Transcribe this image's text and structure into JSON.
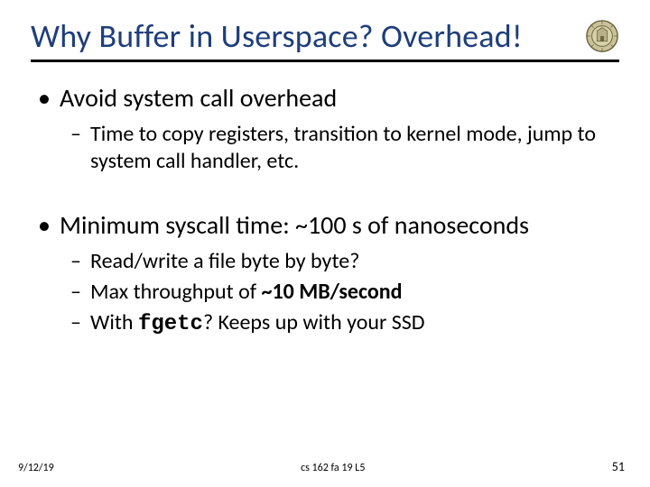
{
  "title": "Why Buffer in Userspace? Overhead!",
  "bullets": {
    "b1": "Avoid system call overhead",
    "b1s1": "Time to copy registers, transition to kernel mode, jump to system call handler, etc.",
    "b2": "Minimum syscall time: ~100 s of nanoseconds",
    "b2s1": "Read/write a file byte by byte?",
    "b2s2_pre": "Max throughput of ",
    "b2s2_bold": "~10 MB/second",
    "b2s3_pre": "With ",
    "b2s3_code": "fgetc",
    "b2s3_post": "? Keeps up with your SSD"
  },
  "footer": {
    "left": "9/12/19",
    "center": "cs 162 fa 19 L5",
    "right": "51"
  }
}
